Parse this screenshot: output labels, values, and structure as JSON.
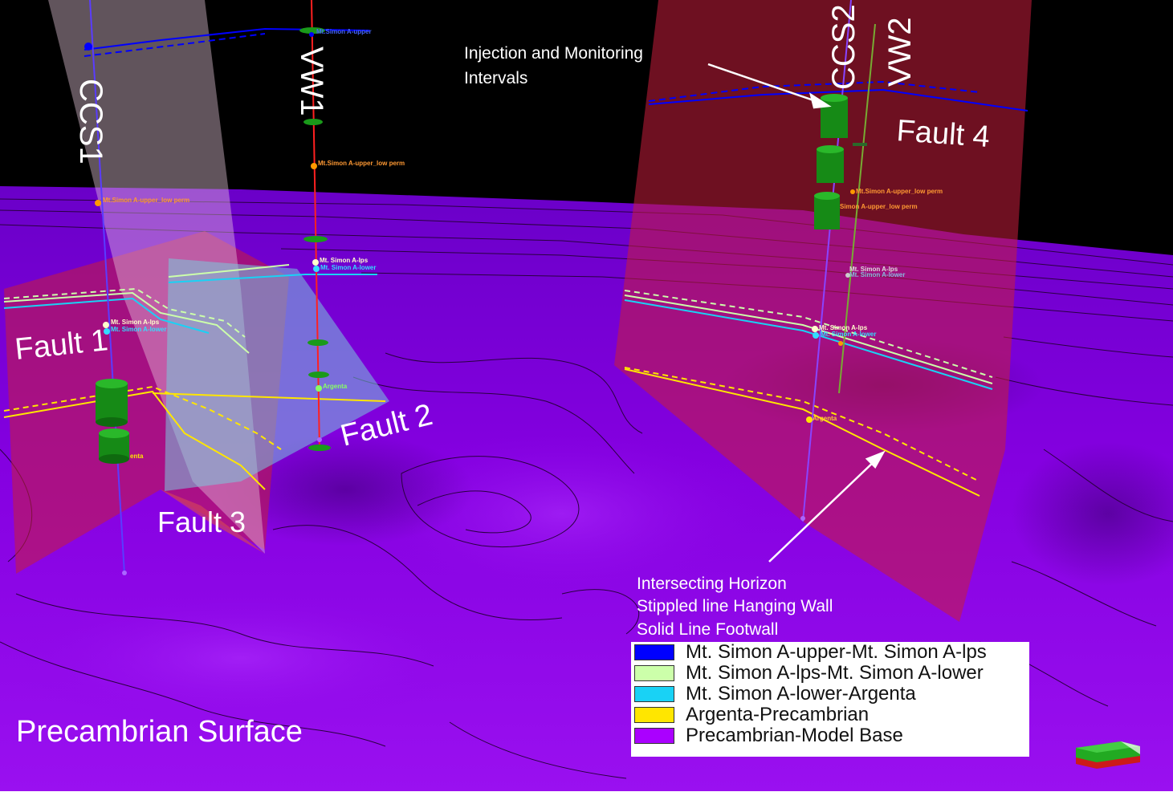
{
  "wells": {
    "ccs1": "CCS1",
    "vw1": "VW1",
    "ccs2": "CCS2",
    "vw2": "VW2"
  },
  "faults": {
    "fault1": "Fault 1",
    "fault2": "Fault 2",
    "fault3": "Fault 3",
    "fault4": "Fault 4"
  },
  "annotations": {
    "injection_line1": "Injection  and  Monitoring",
    "injection_line2": "Intervals",
    "horizon_line1": "Intersecting Horizon",
    "horizon_line2": "Stippled line Hanging Wall",
    "horizon_line3": "Solid Line Footwall",
    "surface_label": "Precambrian Surface"
  },
  "well_markers": {
    "ccs1_upper_low_perm": "Mt.Simon A-upper_low perm",
    "ccs1_lps": "Mt. Simon A-lps",
    "ccs1_lower": "Mt. Simon A-lower",
    "ccs1_argenta": "enta",
    "vw1_upper": "Mt.Simon A-upper",
    "vw1_upper_low_perm": "Mt.Simon A-upper_low perm",
    "vw1_lps": "Mt. Simon A-lps",
    "vw1_lower": "Mt. Simon A-lower",
    "vw1_argenta": "Argenta",
    "vw2_upper_low_perm": "Mt.Simon A-upper_low perm",
    "ccs2_upper_low_perm": "Simon A-upper_low perm",
    "vw2_lps": "Mt. Simon A-lps",
    "vw2_lower": "Mt. Simon A-lower",
    "ccs2_lps": "Mt. Simon A-lps",
    "ccs2_lower": "Mt. Simon A-lower",
    "ccs2_argenta": "Argenta"
  },
  "legend": {
    "items": [
      {
        "label": "Mt. Simon A-upper-Mt. Simon A-lps",
        "color": "#0000ff"
      },
      {
        "label": "Mt. Simon A-lps-Mt. Simon A-lower",
        "color": "#ccffaa"
      },
      {
        "label": "Mt. Simon A-lower-Argenta",
        "color": "#19d2f5"
      },
      {
        "label": "Argenta-Precambrian",
        "color": "#ffe600"
      },
      {
        "label": "Precambrian-Model Base",
        "color": "#aa00ff"
      }
    ]
  },
  "colors": {
    "surface": "#8a00e6",
    "fault_red": "#c81e3c",
    "fault_blue": "#78c8dc",
    "fault_pink": "#e6c8dc"
  }
}
